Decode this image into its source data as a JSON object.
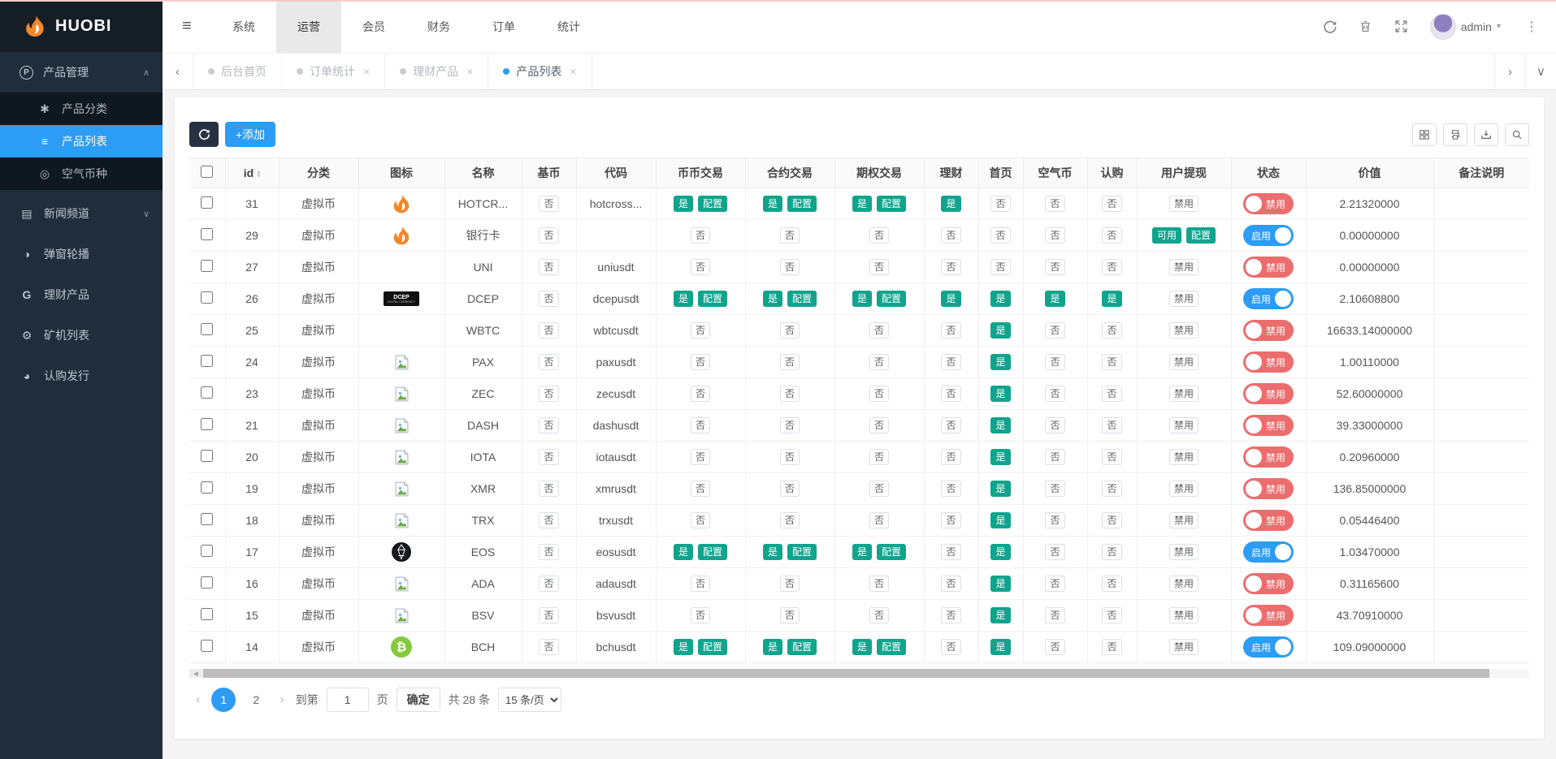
{
  "brand": {
    "name": "HUOBI"
  },
  "header": {
    "nav_items": [
      {
        "label": "系统"
      },
      {
        "label": "运营",
        "active": true
      },
      {
        "label": "会员"
      },
      {
        "label": "财务"
      },
      {
        "label": "订单"
      },
      {
        "label": "统计"
      }
    ],
    "user": {
      "name": "admin"
    }
  },
  "tabbar": {
    "tabs": [
      {
        "label": "后台首页",
        "closable": false,
        "active": false
      },
      {
        "label": "订单统计",
        "closable": true,
        "active": false
      },
      {
        "label": "理财产品",
        "closable": true,
        "active": false
      },
      {
        "label": "产品列表",
        "closable": true,
        "active": true
      }
    ]
  },
  "sidebar": {
    "sections": [
      {
        "label": "产品管理",
        "expanded": true,
        "children": [
          {
            "label": "产品分类",
            "active": false
          },
          {
            "label": "产品列表",
            "active": true
          },
          {
            "label": "空气币种",
            "active": false
          }
        ]
      },
      {
        "label": "新闻频道",
        "expanded": false
      },
      {
        "label": "弹窗轮播"
      },
      {
        "label": "理财产品"
      },
      {
        "label": "矿机列表"
      },
      {
        "label": "认购发行"
      }
    ]
  },
  "toolbar": {
    "add_label": "+添加"
  },
  "table": {
    "columns": [
      "",
      "id",
      "分类",
      "图标",
      "名称",
      "基币",
      "代码",
      "币币交易",
      "合约交易",
      "期权交易",
      "理财",
      "首页",
      "空气币",
      "认购",
      "用户提现",
      "状态",
      "价值",
      "备注说明"
    ],
    "button_labels": {
      "yes": "是",
      "no": "否",
      "config": "配置",
      "available": "可用",
      "forbidden": "禁用",
      "enabled": "启用",
      "disabled": "禁用"
    },
    "rows": [
      {
        "id": "31",
        "category": "虚拟币",
        "icon": "flame",
        "name": "HOTCR...",
        "base": "n",
        "code": "hotcross...",
        "coin": "yc",
        "contract": "yc",
        "option": "yc",
        "finance": "y",
        "home": "n",
        "air": "n",
        "subscribe": "n",
        "withdraw": "forbidden",
        "status": "disabled",
        "value": "2.21320000",
        "note": ""
      },
      {
        "id": "29",
        "category": "虚拟币",
        "icon": "flame",
        "name": "银行卡",
        "base": "n",
        "code": "",
        "coin": "n",
        "contract": "n",
        "option": "n",
        "finance": "n",
        "home": "n",
        "air": "n",
        "subscribe": "n",
        "withdraw": "available",
        "status": "enabled",
        "value": "0.00000000",
        "note": ""
      },
      {
        "id": "27",
        "category": "虚拟币",
        "icon": "none",
        "name": "UNI",
        "base": "n",
        "code": "uniusdt",
        "coin": "n",
        "contract": "n",
        "option": "n",
        "finance": "n",
        "home": "n",
        "air": "n",
        "subscribe": "n",
        "withdraw": "forbidden",
        "status": "disabled",
        "value": "0.00000000",
        "note": ""
      },
      {
        "id": "26",
        "category": "虚拟币",
        "icon": "dcep",
        "name": "DCEP",
        "base": "n",
        "code": "dcepusdt",
        "coin": "yc",
        "contract": "yc",
        "option": "yc",
        "finance": "y",
        "home": "y",
        "air": "y",
        "subscribe": "y",
        "withdraw": "forbidden",
        "status": "enabled",
        "value": "2.10608800",
        "note": ""
      },
      {
        "id": "25",
        "category": "虚拟币",
        "icon": "none",
        "name": "WBTC",
        "base": "n",
        "code": "wbtcusdt",
        "coin": "n",
        "contract": "n",
        "option": "n",
        "finance": "n",
        "home": "y",
        "air": "n",
        "subscribe": "n",
        "withdraw": "forbidden",
        "status": "disabled",
        "value": "16633.14000000",
        "note": ""
      },
      {
        "id": "24",
        "category": "虚拟币",
        "icon": "broken",
        "name": "PAX",
        "base": "n",
        "code": "paxusdt",
        "coin": "n",
        "contract": "n",
        "option": "n",
        "finance": "n",
        "home": "y",
        "air": "n",
        "subscribe": "n",
        "withdraw": "forbidden",
        "status": "disabled",
        "value": "1.00110000",
        "note": ""
      },
      {
        "id": "23",
        "category": "虚拟币",
        "icon": "broken",
        "name": "ZEC",
        "base": "n",
        "code": "zecusdt",
        "coin": "n",
        "contract": "n",
        "option": "n",
        "finance": "n",
        "home": "y",
        "air": "n",
        "subscribe": "n",
        "withdraw": "forbidden",
        "status": "disabled",
        "value": "52.60000000",
        "note": ""
      },
      {
        "id": "21",
        "category": "虚拟币",
        "icon": "broken",
        "name": "DASH",
        "base": "n",
        "code": "dashusdt",
        "coin": "n",
        "contract": "n",
        "option": "n",
        "finance": "n",
        "home": "y",
        "air": "n",
        "subscribe": "n",
        "withdraw": "forbidden",
        "status": "disabled",
        "value": "39.33000000",
        "note": ""
      },
      {
        "id": "20",
        "category": "虚拟币",
        "icon": "broken",
        "name": "IOTA",
        "base": "n",
        "code": "iotausdt",
        "coin": "n",
        "contract": "n",
        "option": "n",
        "finance": "n",
        "home": "y",
        "air": "n",
        "subscribe": "n",
        "withdraw": "forbidden",
        "status": "disabled",
        "value": "0.20960000",
        "note": ""
      },
      {
        "id": "19",
        "category": "虚拟币",
        "icon": "broken",
        "name": "XMR",
        "base": "n",
        "code": "xmrusdt",
        "coin": "n",
        "contract": "n",
        "option": "n",
        "finance": "n",
        "home": "y",
        "air": "n",
        "subscribe": "n",
        "withdraw": "forbidden",
        "status": "disabled",
        "value": "136.85000000",
        "note": ""
      },
      {
        "id": "18",
        "category": "虚拟币",
        "icon": "broken",
        "name": "TRX",
        "base": "n",
        "code": "trxusdt",
        "coin": "n",
        "contract": "n",
        "option": "n",
        "finance": "n",
        "home": "y",
        "air": "n",
        "subscribe": "n",
        "withdraw": "forbidden",
        "status": "disabled",
        "value": "0.05446400",
        "note": ""
      },
      {
        "id": "17",
        "category": "虚拟币",
        "icon": "eos",
        "name": "EOS",
        "base": "n",
        "code": "eosusdt",
        "coin": "yc",
        "contract": "yc",
        "option": "yc",
        "finance": "n",
        "home": "y",
        "air": "n",
        "subscribe": "n",
        "withdraw": "forbidden",
        "status": "enabled",
        "value": "1.03470000",
        "note": ""
      },
      {
        "id": "16",
        "category": "虚拟币",
        "icon": "broken",
        "name": "ADA",
        "base": "n",
        "code": "adausdt",
        "coin": "n",
        "contract": "n",
        "option": "n",
        "finance": "n",
        "home": "y",
        "air": "n",
        "subscribe": "n",
        "withdraw": "forbidden",
        "status": "disabled",
        "value": "0.31165600",
        "note": ""
      },
      {
        "id": "15",
        "category": "虚拟币",
        "icon": "broken",
        "name": "BSV",
        "base": "n",
        "code": "bsvusdt",
        "coin": "n",
        "contract": "n",
        "option": "n",
        "finance": "n",
        "home": "y",
        "air": "n",
        "subscribe": "n",
        "withdraw": "forbidden",
        "status": "disabled",
        "value": "43.70910000",
        "note": ""
      },
      {
        "id": "14",
        "category": "虚拟币",
        "icon": "bch",
        "name": "BCH",
        "base": "n",
        "code": "bchusdt",
        "coin": "yc",
        "contract": "yc",
        "option": "yc",
        "finance": "n",
        "home": "y",
        "air": "n",
        "subscribe": "n",
        "withdraw": "forbidden",
        "status": "enabled",
        "value": "109.09000000",
        "note": ""
      }
    ]
  },
  "pagination": {
    "pages": [
      "1",
      "2"
    ],
    "current": "1",
    "goto_label": "到第",
    "goto_value": "1",
    "page_unit": "页",
    "confirm_label": "确定",
    "total_label": "共 28 条",
    "size_label": "15 条/页"
  }
}
